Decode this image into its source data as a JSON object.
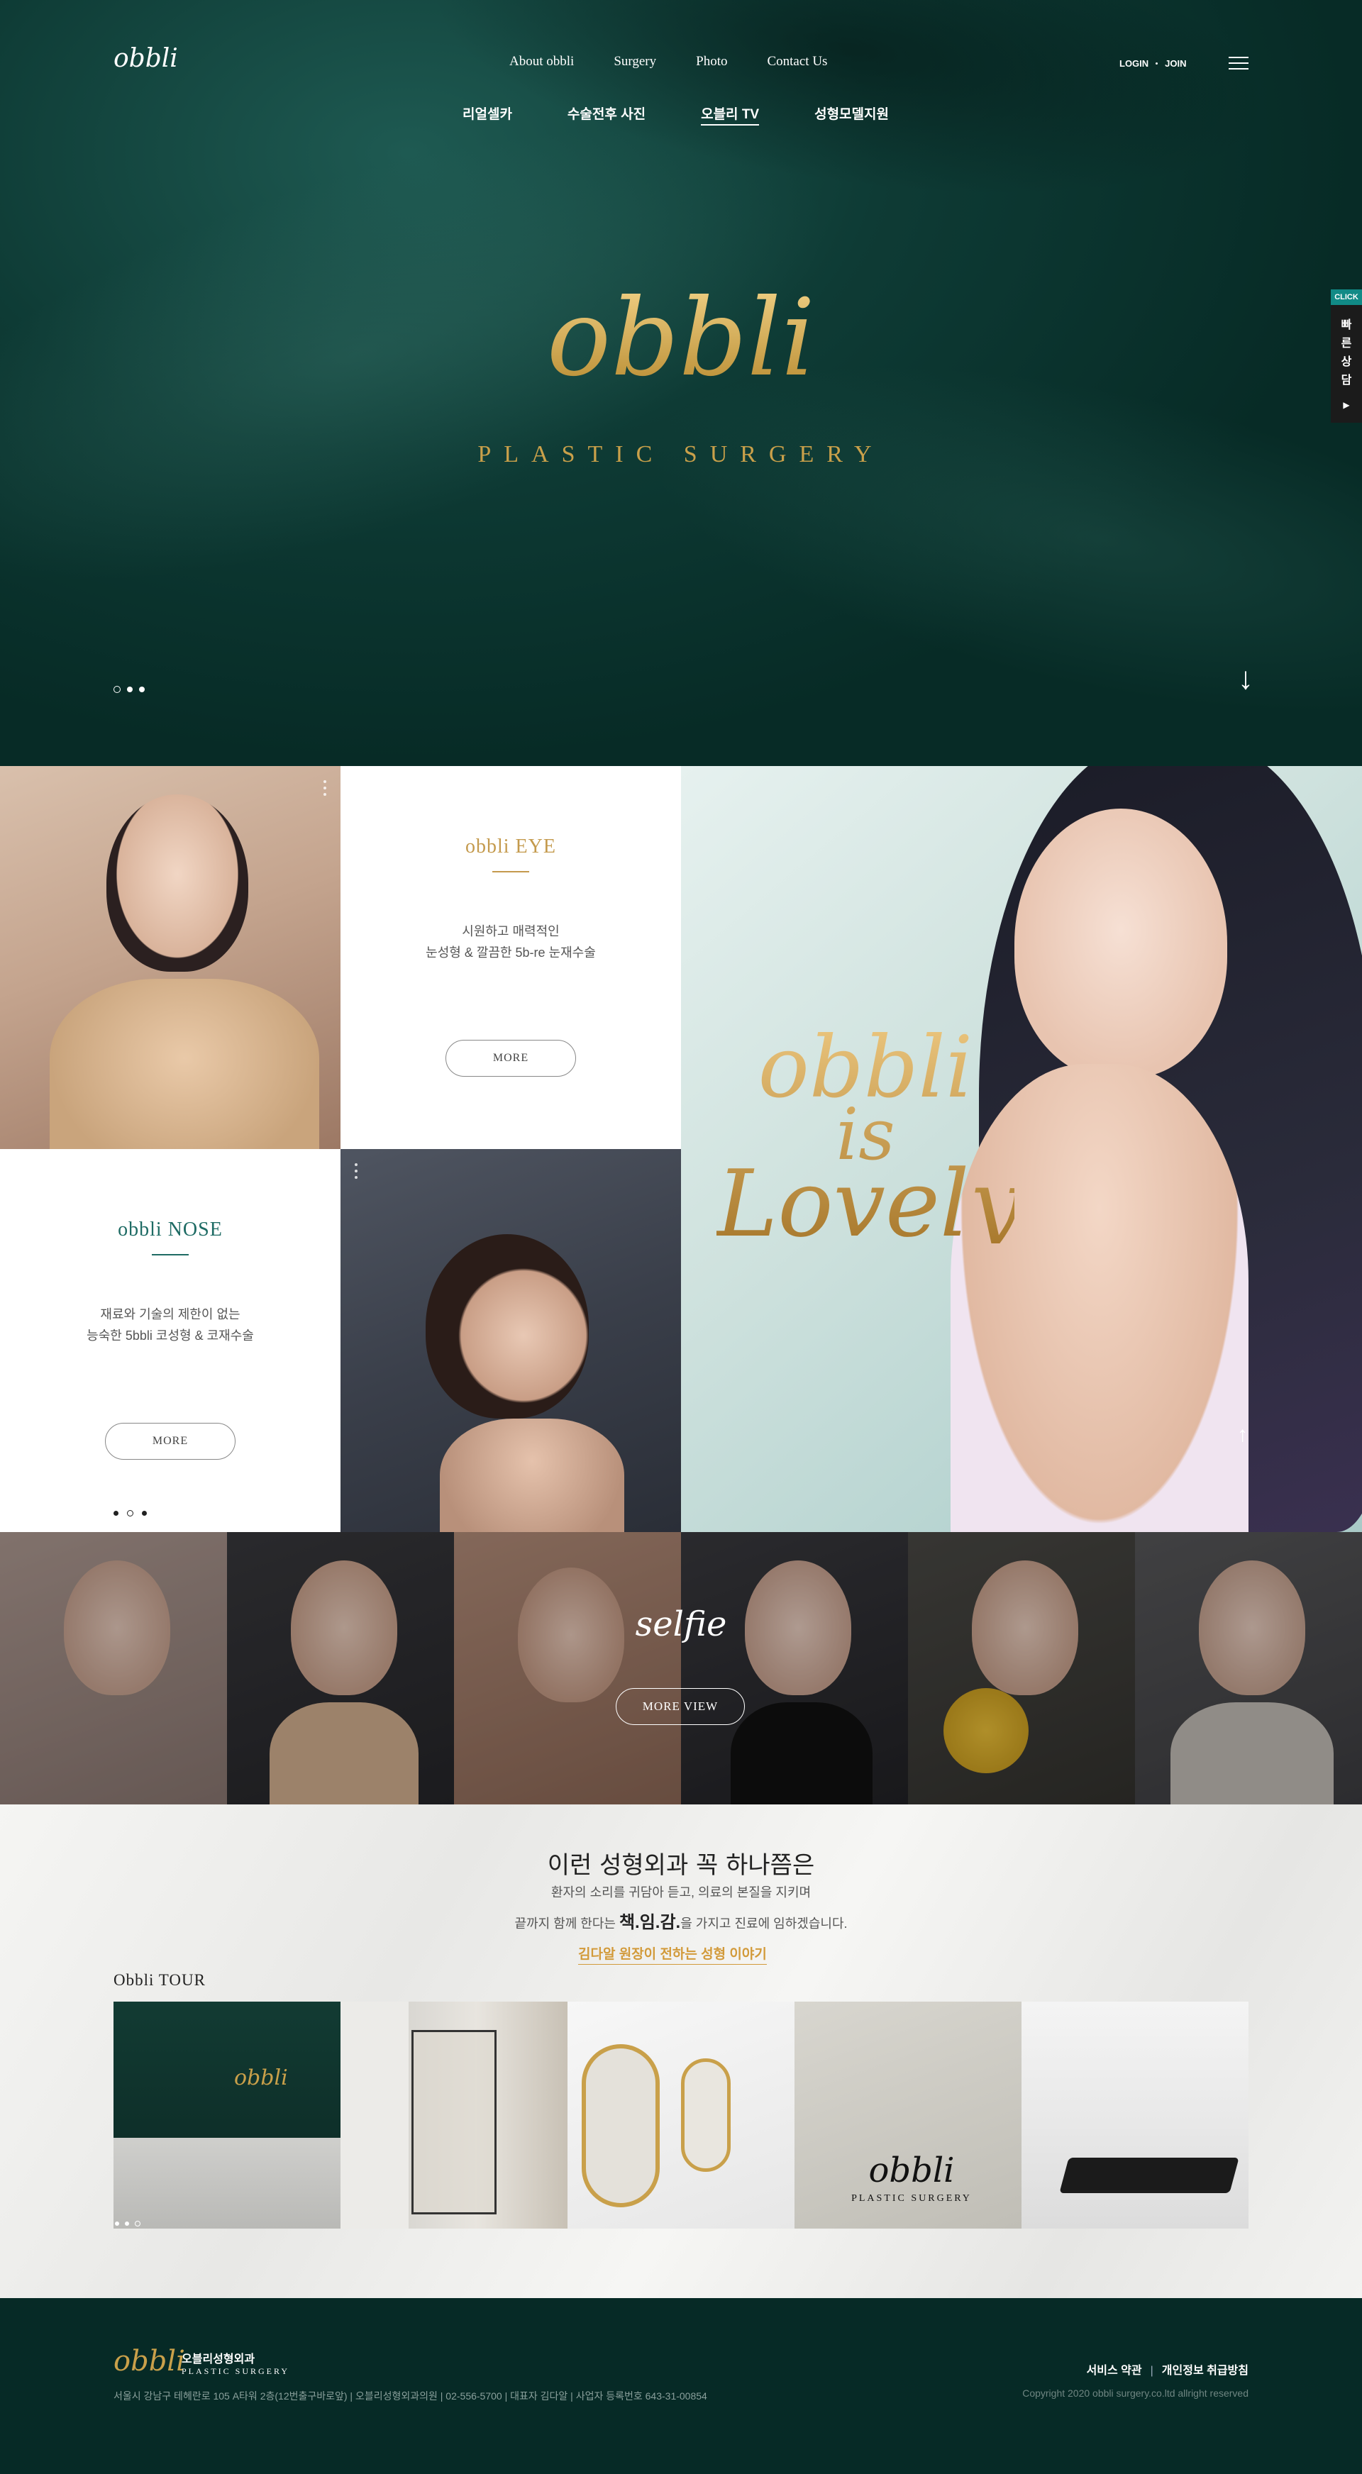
{
  "header": {
    "logo": "obbli",
    "nav": [
      "About obbli",
      "Surgery",
      "Photo",
      "Contact Us"
    ],
    "subnav": [
      "리얼셀카",
      "수술전후 사진",
      "오블리 TV",
      "성형모델지원"
    ],
    "subnav_active": "오블리 TV",
    "login": "LOGIN",
    "join": "JOIN",
    "menu_icon": "hamburger-icon"
  },
  "hero": {
    "logo": "obbli",
    "subtitle": "PLASTIC SURGERY",
    "slide_count": 3,
    "active_slide": 1,
    "scroll_icon": "arrow-down-icon"
  },
  "quick": {
    "click": "CLICK",
    "label": "빠른상담",
    "arrow_icon": "triangle-right-icon"
  },
  "features": {
    "eye": {
      "title": "obbli EYE",
      "line1": "시원하고 매력적인",
      "line2": "눈성형 & 깔끔한 5b-re 눈재수술",
      "more": "MORE",
      "accent": "#c49a4d"
    },
    "nose": {
      "title": "obbli NOSE",
      "line1": "재료와 기술의 제한이 없는",
      "line2": "능숙한 5bbli 코성형 & 코재수술",
      "more": "MORE",
      "accent": "#1e6b64"
    },
    "lovely": {
      "line1": "obbli",
      "line2": "is",
      "line3": "Lovely"
    }
  },
  "selfie": {
    "title": "selfie",
    "button": "MORE VIEW"
  },
  "intro": {
    "heading": "이런 성형외과 꼭 하나쯤은",
    "line1": "환자의 소리를 귀담아 듣고, 의료의 본질을 지키며",
    "line2_pre": "끝까지 함께 한다는",
    "line2_bold": "책.임.감.",
    "line2_post": "을 가지고 진료에 임하겠습니다.",
    "story_link": "김다알 원장이 전하는 성형 이야기",
    "tour_label": "Obbli TOUR"
  },
  "footer": {
    "logo": "obbli",
    "name": "오블리성형외과",
    "name_en": "PLASTIC SURGERY",
    "info": "서울시 강남구 테헤란로 105 A타워 2층(12번출구바로앞)  |  오블리성형외과의원  |  02-556-5700  |  대표자 김다알  |  사업자 등록번호 643-31-00854",
    "terms": "서비스 약관",
    "privacy": "개인정보 취급방침",
    "copyright": "Copyright 2020 obbli surgery.co.ltd allright reserved"
  },
  "colors": {
    "brand_green": "#0b3a34",
    "gold": "#c9a04a"
  }
}
